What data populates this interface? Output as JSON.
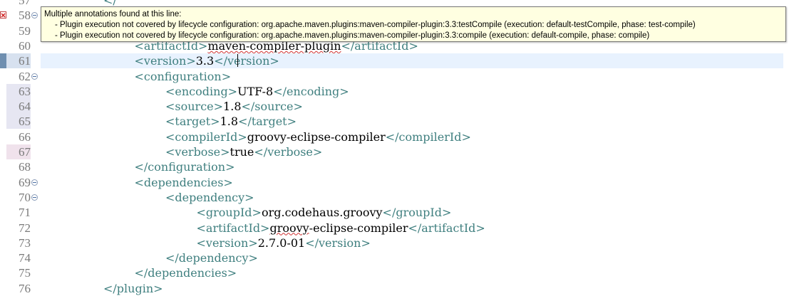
{
  "tooltip": {
    "heading": "Multiple annotations found at this line:",
    "items": [
      "- Plugin execution not covered by lifecycle configuration: org.apache.maven.plugins:maven-compiler-plugin:3.3:testCompile (execution: default-testCompile, phase: test-compile)",
      "- Plugin execution not covered by lifecycle configuration: org.apache.maven.plugins:maven-compiler-plugin:3.3:compile (execution: default-compile, phase: compile)"
    ]
  },
  "lines": [
    {
      "num": "57",
      "indent": 4,
      "parts": [
        {
          "c": "tag",
          "t": "</"
        }
      ],
      "partial": true
    },
    {
      "num": "58",
      "fold": true,
      "error": true,
      "indent": 4,
      "parts": []
    },
    {
      "num": "59",
      "indent": 5,
      "parts": []
    },
    {
      "num": "60",
      "indent": 5,
      "parts": [
        {
          "c": "tag",
          "t": "<artifactId>"
        },
        {
          "c": "txt",
          "t": "maven-compiler-plugin",
          "sq": true
        },
        {
          "c": "tag",
          "t": "</artifactId>"
        }
      ]
    },
    {
      "num": "61",
      "hl": "blue",
      "current": true,
      "indent": 5,
      "parts": [
        {
          "c": "tag",
          "t": "<version>"
        },
        {
          "c": "txt",
          "t": "3.3"
        },
        {
          "c": "tag",
          "t": "</version>"
        }
      ]
    },
    {
      "num": "62",
      "fold": true,
      "indent": 5,
      "parts": [
        {
          "c": "tag",
          "t": "<configuration>"
        }
      ]
    },
    {
      "num": "63",
      "hl": "lav",
      "indent": 6,
      "parts": [
        {
          "c": "tag",
          "t": "<encoding>"
        },
        {
          "c": "txt",
          "t": "UTF-8"
        },
        {
          "c": "tag",
          "t": "</encoding>"
        }
      ]
    },
    {
      "num": "64",
      "hl": "lav",
      "indent": 6,
      "parts": [
        {
          "c": "tag",
          "t": "<source>"
        },
        {
          "c": "txt",
          "t": "1.8"
        },
        {
          "c": "tag",
          "t": "</source>"
        }
      ]
    },
    {
      "num": "65",
      "hl": "lav",
      "indent": 6,
      "parts": [
        {
          "c": "tag",
          "t": "<target>"
        },
        {
          "c": "txt",
          "t": "1.8"
        },
        {
          "c": "tag",
          "t": "</target>"
        }
      ]
    },
    {
      "num": "66",
      "indent": 6,
      "parts": [
        {
          "c": "tag",
          "t": "<compilerId>"
        },
        {
          "c": "txt",
          "t": "groovy-eclipse-compiler"
        },
        {
          "c": "tag",
          "t": "</compilerId>"
        }
      ]
    },
    {
      "num": "67",
      "hl": "pink",
      "indent": 6,
      "parts": [
        {
          "c": "tag",
          "t": "<verbose>"
        },
        {
          "c": "txt",
          "t": "true"
        },
        {
          "c": "tag",
          "t": "</verbose>"
        }
      ]
    },
    {
      "num": "68",
      "indent": 5,
      "parts": [
        {
          "c": "tag",
          "t": "</configuration>"
        }
      ]
    },
    {
      "num": "69",
      "fold": true,
      "indent": 5,
      "parts": [
        {
          "c": "tag",
          "t": "<dependencies>"
        }
      ]
    },
    {
      "num": "70",
      "fold": true,
      "indent": 6,
      "parts": [
        {
          "c": "tag",
          "t": "<dependency>"
        }
      ]
    },
    {
      "num": "71",
      "indent": 7,
      "parts": [
        {
          "c": "tag",
          "t": "<groupId>"
        },
        {
          "c": "txt",
          "t": "org.codehaus.groovy"
        },
        {
          "c": "tag",
          "t": "</groupId>"
        }
      ]
    },
    {
      "num": "72",
      "indent": 7,
      "parts": [
        {
          "c": "tag",
          "t": "<artifactId>"
        },
        {
          "c": "txt",
          "t": "groovy",
          "sq": true
        },
        {
          "c": "txt",
          "t": "-eclipse-compiler"
        },
        {
          "c": "tag",
          "t": "</artifactId>"
        }
      ]
    },
    {
      "num": "73",
      "indent": 7,
      "parts": [
        {
          "c": "tag",
          "t": "<version>"
        },
        {
          "c": "txt",
          "t": "2.7.0-01"
        },
        {
          "c": "tag",
          "t": "</version>"
        }
      ]
    },
    {
      "num": "74",
      "indent": 6,
      "parts": [
        {
          "c": "tag",
          "t": "</dependency>"
        }
      ]
    },
    {
      "num": "75",
      "indent": 5,
      "parts": [
        {
          "c": "tag",
          "t": "</dependencies>"
        }
      ]
    },
    {
      "num": "76",
      "indent": 4,
      "parts": [
        {
          "c": "tag",
          "t": "</plugin>"
        }
      ]
    }
  ]
}
